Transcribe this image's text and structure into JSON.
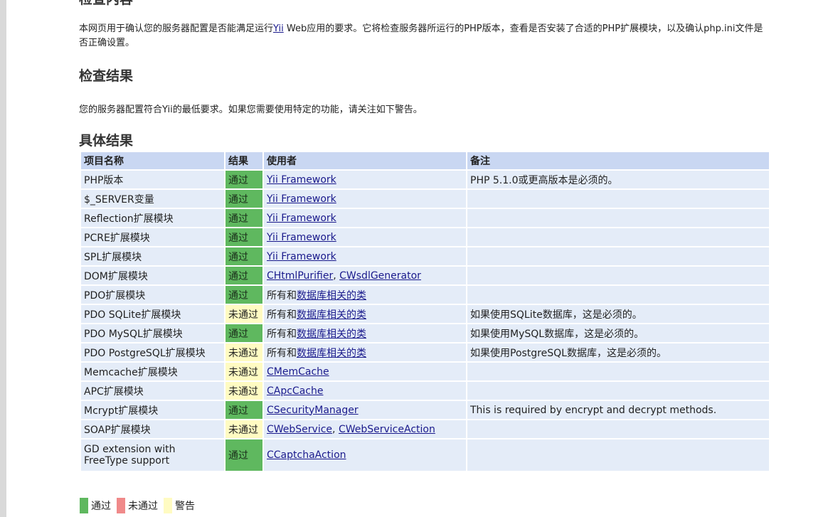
{
  "page": {
    "top_heading": "检查内容",
    "intro_parts": {
      "before": "本网页用于确认您的服务器配置是否能满足运行",
      "link": "Yii",
      "after": " Web应用的要求。它将检查服务器所运行的PHP版本，查看是否安装了合适的PHP扩展模块，以及确认php.ini文件是否正确设置。"
    },
    "result_heading": "检查结果",
    "result_summary": "您的服务器配置符合Yii的最低要求。如果您需要使用特定的功能，请关注如下警告。",
    "detail_heading": "具体结果"
  },
  "table": {
    "headers": {
      "name": "项目名称",
      "result": "结果",
      "used_by": "使用者",
      "memo": "备注"
    },
    "rows": [
      {
        "name": "PHP版本",
        "result": "通过",
        "status": "pass",
        "used_by_prefix": "",
        "used_by_links": [
          "Yii Framework"
        ],
        "memo": "PHP 5.1.0或更高版本是必须的。"
      },
      {
        "name": "$_SERVER变量",
        "result": "通过",
        "status": "pass",
        "used_by_prefix": "",
        "used_by_links": [
          "Yii Framework"
        ],
        "memo": ""
      },
      {
        "name": "Reflection扩展模块",
        "result": "通过",
        "status": "pass",
        "used_by_prefix": "",
        "used_by_links": [
          "Yii Framework"
        ],
        "memo": ""
      },
      {
        "name": "PCRE扩展模块",
        "result": "通过",
        "status": "pass",
        "used_by_prefix": "",
        "used_by_links": [
          "Yii Framework"
        ],
        "memo": ""
      },
      {
        "name": "SPL扩展模块",
        "result": "通过",
        "status": "pass",
        "used_by_prefix": "",
        "used_by_links": [
          "Yii Framework"
        ],
        "memo": ""
      },
      {
        "name": "DOM扩展模块",
        "result": "通过",
        "status": "pass",
        "used_by_prefix": "",
        "used_by_links": [
          "CHtmlPurifier",
          "CWsdlGenerator"
        ],
        "memo": ""
      },
      {
        "name": "PDO扩展模块",
        "result": "通过",
        "status": "pass",
        "used_by_prefix": "所有和",
        "used_by_links": [
          "数据库相关的类"
        ],
        "memo": ""
      },
      {
        "name": "PDO SQLite扩展模块",
        "result": "未通过",
        "status": "warn",
        "used_by_prefix": "所有和",
        "used_by_links": [
          "数据库相关的类"
        ],
        "memo": "如果使用SQLite数据库，这是必须的。"
      },
      {
        "name": "PDO MySQL扩展模块",
        "result": "通过",
        "status": "pass",
        "used_by_prefix": "所有和",
        "used_by_links": [
          "数据库相关的类"
        ],
        "memo": "如果使用MySQL数据库，这是必须的。"
      },
      {
        "name": "PDO PostgreSQL扩展模块",
        "result": "未通过",
        "status": "warn",
        "used_by_prefix": "所有和",
        "used_by_links": [
          "数据库相关的类"
        ],
        "memo": "如果使用PostgreSQL数据库，这是必须的。"
      },
      {
        "name": "Memcache扩展模块",
        "result": "未通过",
        "status": "warn",
        "used_by_prefix": "",
        "used_by_links": [
          "CMemCache"
        ],
        "memo": ""
      },
      {
        "name": "APC扩展模块",
        "result": "未通过",
        "status": "warn",
        "used_by_prefix": "",
        "used_by_links": [
          "CApcCache"
        ],
        "memo": ""
      },
      {
        "name": "Mcrypt扩展模块",
        "result": "通过",
        "status": "pass",
        "used_by_prefix": "",
        "used_by_links": [
          "CSecurityManager"
        ],
        "memo": "This is required by encrypt and decrypt methods."
      },
      {
        "name": "SOAP扩展模块",
        "result": "未通过",
        "status": "warn",
        "used_by_prefix": "",
        "used_by_links": [
          "CWebService",
          "CWebServiceAction"
        ],
        "memo": ""
      },
      {
        "name": "GD extension with FreeType support",
        "result": "通过",
        "status": "pass",
        "used_by_prefix": "",
        "used_by_links": [
          "CCaptchaAction"
        ],
        "memo": ""
      }
    ]
  },
  "legend": [
    {
      "label": "通过",
      "color": "#5fb85f"
    },
    {
      "label": "未通过",
      "color": "#f08a8a"
    },
    {
      "label": "警告",
      "color": "#fffbc2"
    }
  ]
}
